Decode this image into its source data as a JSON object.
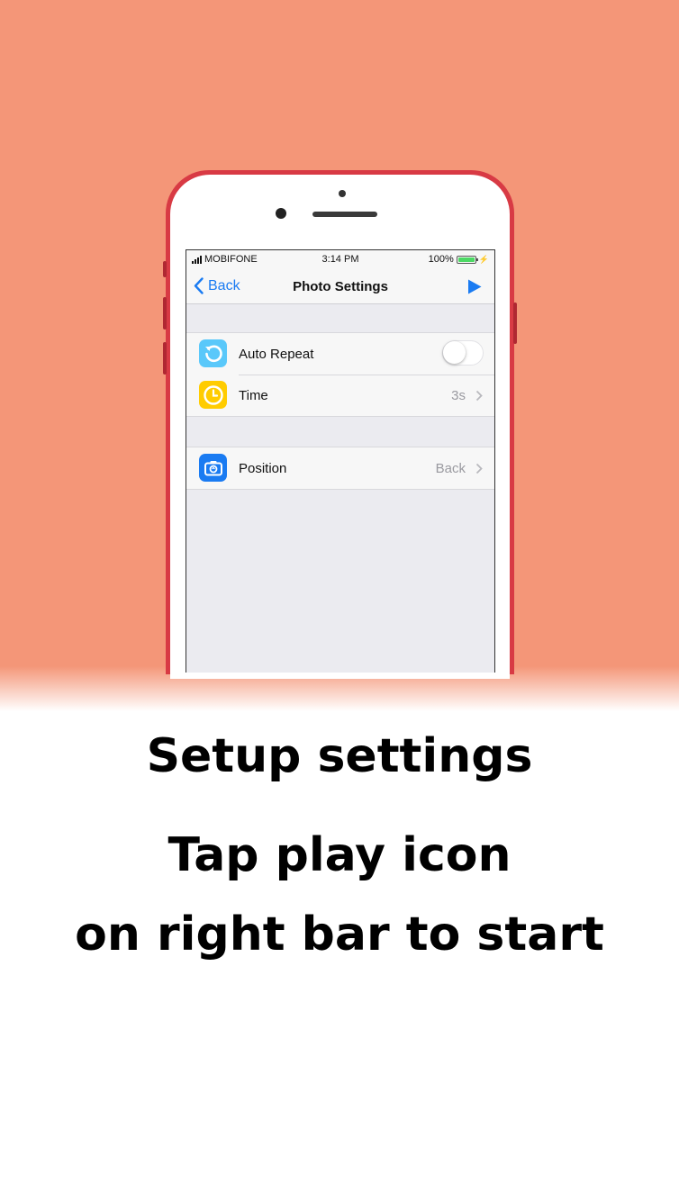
{
  "status_bar": {
    "carrier": "MOBIFONE",
    "time": "3:14 PM",
    "battery_percent": "100%",
    "battery_level": 1.0
  },
  "nav_bar": {
    "back_label": "Back",
    "title": "Photo Settings",
    "play_icon": "play-icon"
  },
  "settings": {
    "auto_repeat": {
      "label": "Auto Repeat",
      "icon": "repeat-icon",
      "icon_color": "#5ac8fa",
      "enabled": false
    },
    "time": {
      "label": "Time",
      "value": "3s",
      "icon": "clock-icon",
      "icon_color": "#ffcc00"
    },
    "position": {
      "label": "Position",
      "value": "Back",
      "icon": "camera-switch-icon",
      "icon_color": "#1a7bf2"
    }
  },
  "caption": {
    "line1": "Setup settings",
    "line2": "Tap play icon",
    "line3": "on right bar to start"
  },
  "colors": {
    "background": "#f49678",
    "phone_body": "#d83a44",
    "accent": "#1a7bf2"
  }
}
